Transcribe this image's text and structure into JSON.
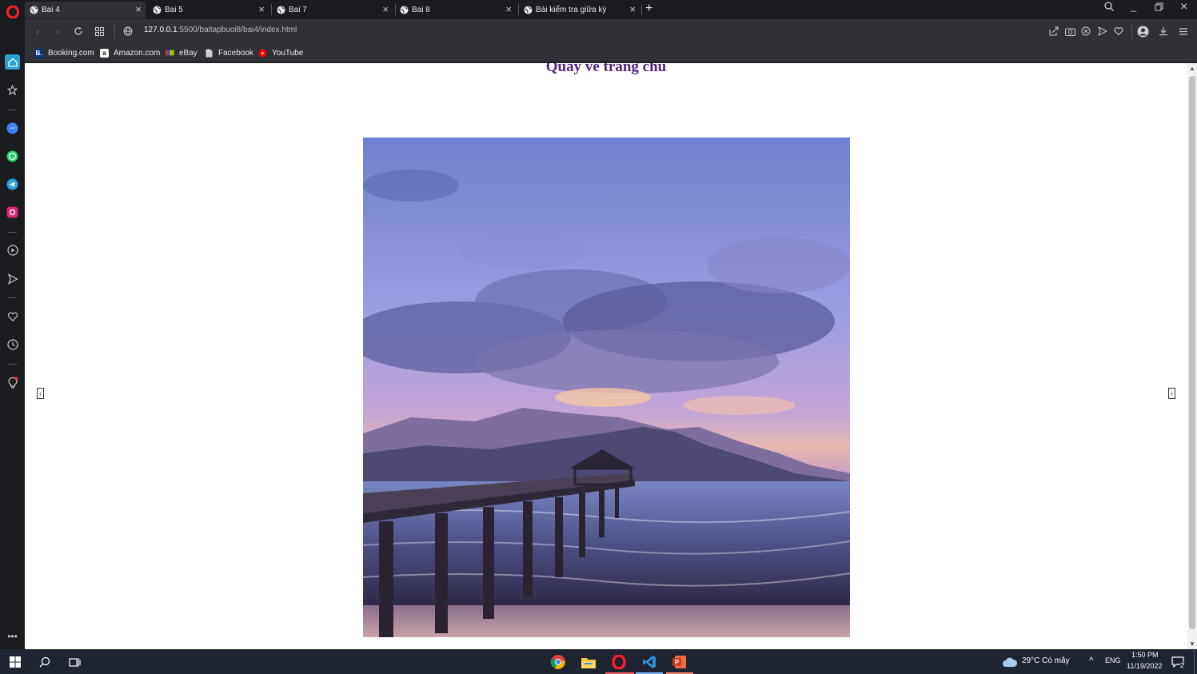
{
  "tabs": [
    {
      "title": "Bai 4",
      "active": true
    },
    {
      "title": "Bai 5",
      "active": false
    },
    {
      "title": "Bai 7",
      "active": false
    },
    {
      "title": "Bai 8",
      "active": false
    },
    {
      "title": "Bài kiểm tra giữa kỳ",
      "active": false
    }
  ],
  "address": {
    "host": "127.0.0.1",
    "path": ":5500/baitapbuoi8/bai4/index.html"
  },
  "bookmarks": [
    {
      "label": "Booking.com",
      "icon": "booking-icon",
      "color": "#003580"
    },
    {
      "label": "Amazon.com",
      "icon": "amazon-icon",
      "color": "#ffffff"
    },
    {
      "label": "eBay",
      "icon": "ebay-icon",
      "color": "#e53238"
    },
    {
      "label": "Facebook",
      "icon": "document-icon",
      "color": "#d0d0d0"
    },
    {
      "label": "YouTube",
      "icon": "youtube-icon",
      "color": "#ff0000"
    }
  ],
  "page": {
    "heading": "Quay về trang chủ",
    "heading_color": "#52237a",
    "slider_image": "sunset-pier-with-clouds",
    "prev_symbol": "‹",
    "next_symbol": "›"
  },
  "sidebar_icons": [
    "home-icon",
    "star-icon",
    "messenger-icon",
    "whatsapp-icon",
    "telegram-icon",
    "instagram-icon",
    "player-icon",
    "send-icon",
    "heart-icon",
    "history-icon",
    "bulb-icon",
    "more-icon"
  ],
  "taskbar": {
    "apps": [
      "chrome-icon",
      "file-explorer-icon",
      "opera-icon",
      "vscode-icon",
      "powerpoint-icon"
    ],
    "weather": "29°C  Có mây",
    "language": "ENG",
    "time": "1:50 PM",
    "date": "11/19/2022",
    "notification_count": "2"
  },
  "colors": {
    "browser_dark": "#1b1c20",
    "toolbar": "#2f3136",
    "taskbar": "#1e2430",
    "accent_opera": "#ff1b2d"
  }
}
